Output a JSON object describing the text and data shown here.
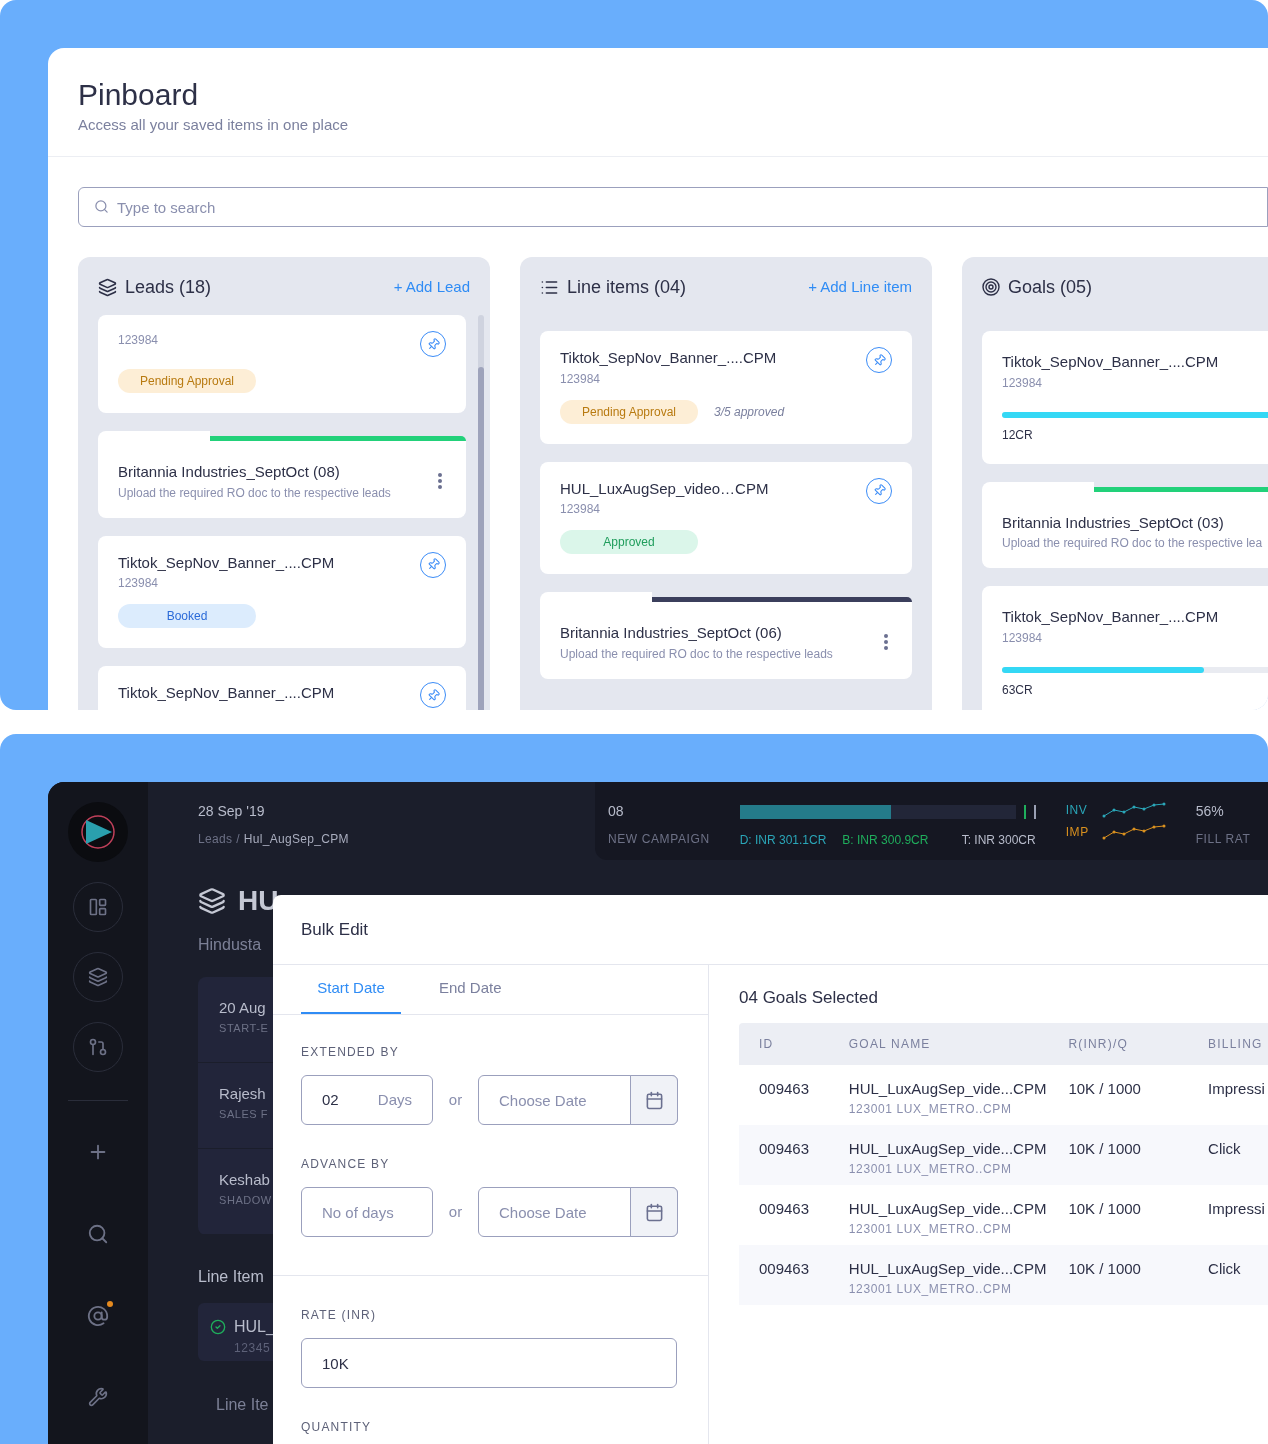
{
  "pinboard": {
    "title": "Pinboard",
    "subtitle": "Access all your saved items in one place",
    "search": {
      "placeholder": "Type to search"
    },
    "columns": [
      {
        "kind": "leads",
        "title": "Leads (18)",
        "action": "+ Add Lead",
        "cards": [
          {
            "kind": "item",
            "id": "123984",
            "badge": {
              "label": "Pending Approval",
              "kind": "pending"
            }
          },
          {
            "kind": "group",
            "title": "Britannia Industries_SeptOct (08)",
            "subtitle": "Upload the required RO doc to the respective leads",
            "color": "#22d17a",
            "menu": true
          },
          {
            "kind": "item",
            "title": "Tiktok_SepNov_Banner_....CPM",
            "id": "123984",
            "badge": {
              "label": "Booked",
              "kind": "booked"
            }
          },
          {
            "kind": "item",
            "title": "Tiktok_SepNov_Banner_....CPM"
          }
        ]
      },
      {
        "kind": "list",
        "title": "Line items (04)",
        "action": "+ Add Line item",
        "cards": [
          {
            "kind": "item",
            "title": "Tiktok_SepNov_Banner_....CPM",
            "id": "123984",
            "badge": {
              "label": "Pending Approval",
              "kind": "pending"
            },
            "note": "3/5 approved"
          },
          {
            "kind": "item",
            "title": "HUL_LuxAugSep_video…CPM",
            "id": "123984",
            "badge": {
              "label": "Approved",
              "kind": "approved"
            }
          },
          {
            "kind": "group",
            "title": "Britannia Industries_SeptOct (06)",
            "subtitle": "Upload the required RO doc to the respective leads",
            "color": "#3b3f5c",
            "menu": true
          }
        ]
      },
      {
        "kind": "goals",
        "title": "Goals (05)",
        "cards": [
          {
            "kind": "goal",
            "title": "Tiktok_SepNov_Banner_....CPM",
            "id": "123984",
            "level": 1,
            "amount": "12CR"
          },
          {
            "kind": "group",
            "title": "Britannia Industries_SeptOct (03)",
            "subtitle": "Upload the required RO doc to the respective lea",
            "color": "#22d17a"
          },
          {
            "kind": "goal",
            "title": "Tiktok_SepNov_Banner_....CPM",
            "id": "123984",
            "level": 0.72,
            "amount": "63CR"
          }
        ]
      }
    ]
  },
  "app": {
    "date": "28 Sep '19",
    "breadcrumb": {
      "parent": "Leads",
      "separator": "/",
      "current": "Hul_AugSep_CPM"
    },
    "stats": {
      "count": "08",
      "count_label": "NEW CAMPAIGN",
      "budget": {
        "level": 0.55,
        "delivered": "D: INR 301.1CR",
        "booked": "B: INR 300.9CR",
        "target": "T: INR 300CR"
      },
      "trends": [
        {
          "label": "INV",
          "color": "#2aa6b8"
        },
        {
          "label": "IMP",
          "color": "#d9901f"
        }
      ],
      "fill": "56%",
      "fill_label": "FILL RAT"
    },
    "background": {
      "heading": "HU",
      "subheading": "Hindusta",
      "details": [
        {
          "value": "20 Aug",
          "label": "START-E"
        },
        {
          "value": "Rajesh",
          "label": "SALES F"
        },
        {
          "value": "Keshab",
          "label": "SHADOW"
        }
      ],
      "section": "Line Item",
      "line_item": {
        "name": "HUL_",
        "id": "12345"
      },
      "section_2": "Line Ite"
    }
  },
  "modal": {
    "title": "Bulk Edit",
    "tabs": [
      {
        "label": "Start Date",
        "selected": true
      },
      {
        "label": "End Date",
        "selected": false
      }
    ],
    "extended_by": {
      "label": "EXTENDED BY",
      "days": "02",
      "unit": "Days",
      "or": "or",
      "date_placeholder": "Choose Date"
    },
    "advance_by": {
      "label": "ADVANCE BY",
      "days_placeholder": "No of days",
      "or": "or",
      "date_placeholder": "Choose Date"
    },
    "rate": {
      "label": "RATE (INR)",
      "value": "10K"
    },
    "quantity": {
      "label": "QUANTITY"
    },
    "selection": {
      "title": "04 Goals Selected",
      "columns": [
        "ID",
        "GOAL NAME",
        "R(INR)/Q",
        "BILLING"
      ],
      "rows": [
        {
          "id": "009463",
          "name": "HUL_LuxAugSep_vide...CPM",
          "sub": "123001 LUX_METRO..CPM",
          "rate": "10K / 1000",
          "billing": "Impressi"
        },
        {
          "id": "009463",
          "name": "HUL_LuxAugSep_vide...CPM",
          "sub": "123001 LUX_METRO..CPM",
          "rate": "10K / 1000",
          "billing": "Click"
        },
        {
          "id": "009463",
          "name": "HUL_LuxAugSep_vide...CPM",
          "sub": "123001 LUX_METRO..CPM",
          "rate": "10K / 1000",
          "billing": "Impressi"
        },
        {
          "id": "009463",
          "name": "HUL_LuxAugSep_vide...CPM",
          "sub": "123001 LUX_METRO..CPM",
          "rate": "10K / 1000",
          "billing": "Click"
        }
      ]
    }
  }
}
